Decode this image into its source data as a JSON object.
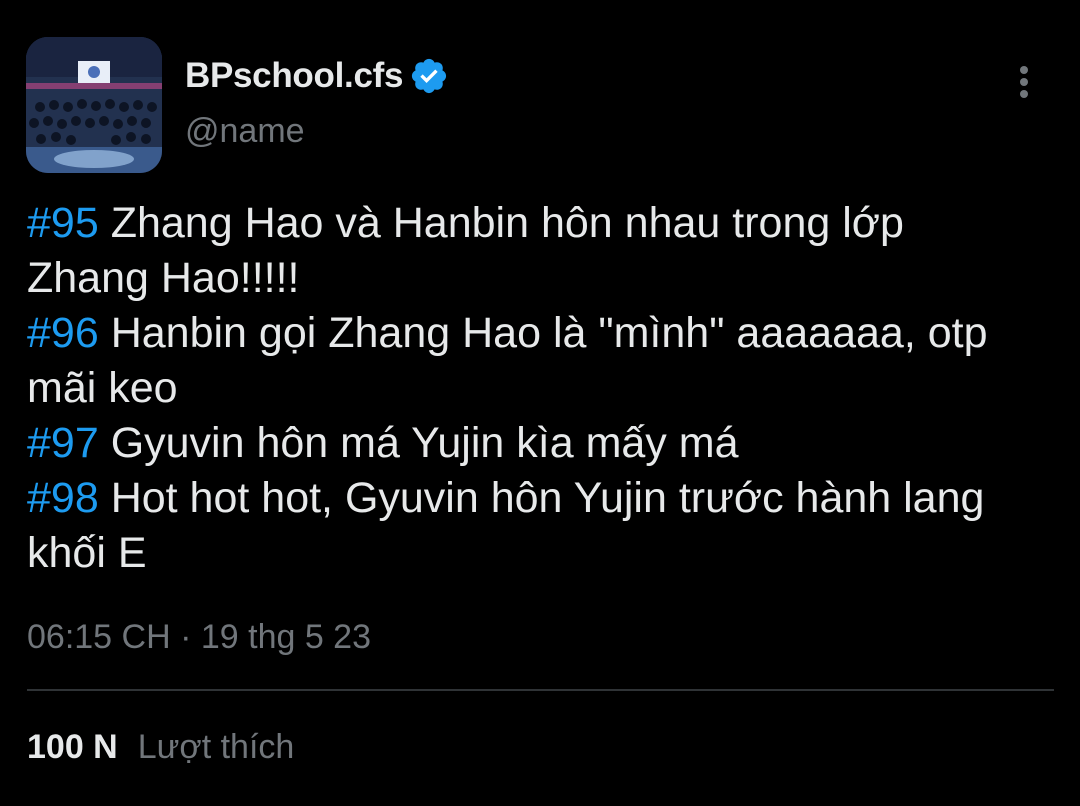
{
  "account": {
    "display_name": "BPschool.cfs",
    "handle": "@name",
    "avatar": "group-stage-photo",
    "verified_icon": "verified-badge-icon",
    "verified_color": "#1d9bf0"
  },
  "more_icon": "vertical-dots-icon",
  "tweet": {
    "lines": [
      {
        "hashtag": "#95",
        "text": " Zhang Hao và Hanbin hôn nhau trong lớp"
      },
      {
        "hashtag": "",
        "text": "Zhang Hao!!!!!"
      },
      {
        "hashtag": "#96",
        "text": " Hanbin gọi Zhang Hao là \"mình\" aaaaaaa, otp"
      },
      {
        "hashtag": "",
        "text": "mãi keo"
      },
      {
        "hashtag": "#97",
        "text": " Gyuvin hôn má Yujin kìa mấy má"
      },
      {
        "hashtag": "#98",
        "text": " Hot hot hot, Gyuvin hôn Yujin trước hành lang"
      },
      {
        "hashtag": "",
        "text": "khối E"
      }
    ],
    "timestamp": "06:15 CH · 19 thg 5 23"
  },
  "stats": {
    "likes_count": "100 N",
    "likes_label": "Lượt thích"
  },
  "colors": {
    "background": "#000000",
    "primary_text": "#e7e9ea",
    "secondary_text": "#71767b",
    "hashtag": "#1d9bf0",
    "divider": "#2f3336"
  }
}
